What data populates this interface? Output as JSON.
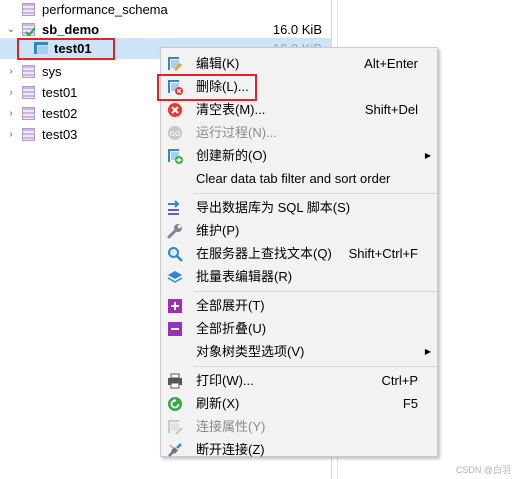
{
  "tree": {
    "items": [
      {
        "label": "performance_schema",
        "size": "",
        "bold": false
      },
      {
        "label": "sb_demo",
        "size": "16.0 KiB",
        "bold": true
      },
      {
        "label": "test01",
        "size": "16.0 KiB",
        "bold": true
      },
      {
        "label": "sys",
        "size": "",
        "bold": false
      },
      {
        "label": "test01",
        "size": "",
        "bold": false
      },
      {
        "label": "test02",
        "size": "",
        "bold": false
      },
      {
        "label": "test03",
        "size": "",
        "bold": false
      }
    ]
  },
  "menu": {
    "items": [
      {
        "label": "编辑(K)",
        "shortcut": "Alt+Enter",
        "icon": "edit-icon"
      },
      {
        "label": "删除(L)...",
        "shortcut": "",
        "icon": "delete-table-icon"
      },
      {
        "label": "清空表(M)...",
        "shortcut": "Shift+Del",
        "icon": "clear-icon"
      },
      {
        "label": "运行过程(N)...",
        "shortcut": "",
        "icon": "run-icon"
      },
      {
        "label": "创建新的(O)",
        "shortcut": "",
        "icon": "create-icon"
      },
      {
        "label": "Clear data tab filter and sort order",
        "shortcut": "",
        "icon": ""
      },
      {
        "label": "导出数据库为 SQL 脚本(S)",
        "shortcut": "",
        "icon": "export-icon"
      },
      {
        "label": "维护(P)",
        "shortcut": "",
        "icon": "wrench-icon"
      },
      {
        "label": "在服务器上查找文本(Q)",
        "shortcut": "Shift+Ctrl+F",
        "icon": "search-icon"
      },
      {
        "label": "批量表编辑器(R)",
        "shortcut": "",
        "icon": "layers-icon"
      },
      {
        "label": "全部展开(T)",
        "shortcut": "",
        "icon": "expand-icon"
      },
      {
        "label": "全部折叠(U)",
        "shortcut": "",
        "icon": "collapse-icon"
      },
      {
        "label": "对象树类型选项(V)",
        "shortcut": "",
        "icon": ""
      },
      {
        "label": "打印(W)...",
        "shortcut": "Ctrl+P",
        "icon": "printer-icon"
      },
      {
        "label": "刷新(X)",
        "shortcut": "F5",
        "icon": "refresh-icon"
      },
      {
        "label": "连接属性(Y)",
        "shortcut": "",
        "icon": "properties-icon"
      },
      {
        "label": "断开连接(Z)",
        "shortcut": "",
        "icon": "disconnect-icon"
      }
    ]
  },
  "watermark": "CSDN @白羽",
  "colors": {
    "highlight": "#e0242a",
    "selection": "#cce4f7",
    "menu_bg": "#f2f2f2",
    "purple": "#9b2fb5"
  }
}
